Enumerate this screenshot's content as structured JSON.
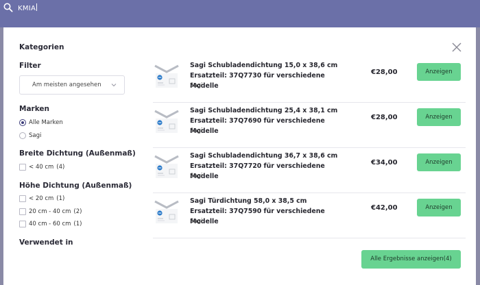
{
  "search": {
    "query": "KMIA"
  },
  "sidebar": {
    "title": "Kategorien",
    "filter_label": "Filter",
    "sort": {
      "selected": "Am meisten angesehen"
    },
    "brands": {
      "heading": "Marken",
      "options": [
        {
          "label": "Alle Marken",
          "selected": true
        },
        {
          "label": "Sagi",
          "selected": false
        }
      ]
    },
    "width": {
      "heading": "Breite Dichtung (Außenmaß)",
      "options": [
        {
          "label": "< 40 cm",
          "count": "(4)",
          "checked": false
        }
      ]
    },
    "height": {
      "heading": "Höhe Dichtung (Außenmaß)",
      "options": [
        {
          "label": "< 20 cm",
          "count": "(1)",
          "checked": false
        },
        {
          "label": "20 cm - 40 cm",
          "count": "(2)",
          "checked": false
        },
        {
          "label": "40 cm - 60 cm",
          "count": "(1)",
          "checked": false
        }
      ]
    },
    "used_in": {
      "heading": "Verwendet in"
    }
  },
  "results": [
    {
      "title": "Sagi Schubladendichtung 15,0 x 38,6 cm Ersatzteil: 37Q7730 für verschiedene Modelle",
      "brand": "Sagi",
      "price": "€28,00",
      "button": "Anzeigen"
    },
    {
      "title": "Sagi Schubladendichtung 25,4 x 38,1 cm Ersatzteil: 37Q7690 für verschiedene Modelle",
      "brand": "Sagi",
      "price": "€28,00",
      "button": "Anzeigen"
    },
    {
      "title": "Sagi Schubladendichtung 36,7 x 38,6 cm Ersatzteil: 37Q7720 für verschiedene Modelle",
      "brand": "Sagi",
      "price": "€34,00",
      "button": "Anzeigen"
    },
    {
      "title": "Sagi Türdichtung 58,0 x 38,5 cm Ersatzteil: 37Q7590 für verschiedene Modelle",
      "brand": "Sagi",
      "price": "€42,00",
      "button": "Anzeigen"
    }
  ],
  "all_results_button": "Alle Ergebnisse anzeigen(4)",
  "colors": {
    "topbar": "#6b70a8",
    "button": "#68d391",
    "accent": "#3d3d7a"
  }
}
